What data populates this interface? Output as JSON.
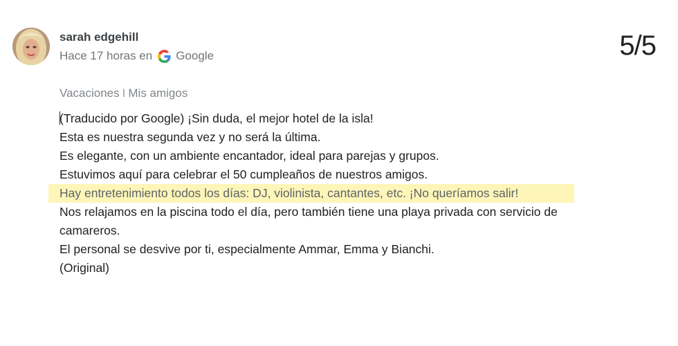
{
  "review": {
    "author": "sarah edgehill",
    "time_text": "Hace 17 horas en",
    "source": "Google",
    "rating": "5/5",
    "trip_tags": [
      "Vacaciones",
      "Mis amigos"
    ],
    "tag_separator": "I",
    "lines": [
      "(Traducido por Google) ¡Sin duda, el mejor hotel de la isla!",
      "Esta es nuestra segunda vez y no será la última.",
      "Es elegante, con un ambiente encantador, ideal para parejas y grupos.",
      "Estuvimos aquí para celebrar el 50 cumpleaños de nuestros amigos.",
      "Hay entretenimiento todos los días: DJ, violinista, cantantes, etc. ¡No queríamos salir!",
      "Nos relajamos en la piscina todo el día, pero también tiene una playa privada con servicio de",
      "camareros.",
      "El personal se desvive por ti, especialmente Ammar, Emma y Bianchi."
    ],
    "highlighted_line_index": 4,
    "original_link": "(Original)"
  },
  "icons": {
    "avatar": "user-avatar-photo",
    "source_icon": "google-g-icon"
  },
  "colors": {
    "highlight": "#fdf6b8",
    "secondary_text": "#70757a",
    "google_blue": "#4285F4",
    "google_red": "#EA4335",
    "google_yellow": "#FBBC05",
    "google_green": "#34A853"
  }
}
